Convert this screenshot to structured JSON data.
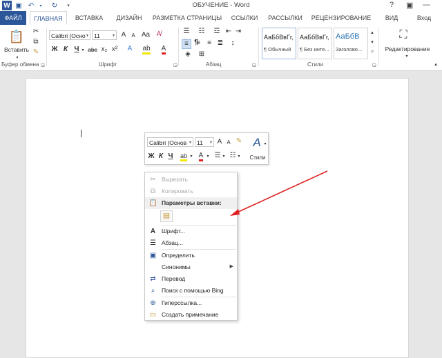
{
  "window": {
    "title": "ОБУЧЕНИЕ - Word",
    "help": "?",
    "signin": "Вход"
  },
  "tabs": [
    {
      "label": "ФАЙЛ"
    },
    {
      "label": "ГЛАВНАЯ"
    },
    {
      "label": "ВСТАВКА"
    },
    {
      "label": "ДИЗАЙН"
    },
    {
      "label": "РАЗМЕТКА СТРАНИЦЫ"
    },
    {
      "label": "ССЫЛКИ"
    },
    {
      "label": "РАССЫЛКИ"
    },
    {
      "label": "РЕЦЕНЗИРОВАНИЕ"
    },
    {
      "label": "ВИД"
    }
  ],
  "ribbon": {
    "paste_label": "Вставить",
    "clipboard_label": "Буфер обмена",
    "font_label": "Шрифт",
    "paragraph_label": "Абзац",
    "styles_label": "Стили",
    "font_name": "Calibri (Осно",
    "font_size": "11",
    "bold": "Ж",
    "italic": "К",
    "underline": "Ч",
    "strike": "abc",
    "sub": "x₂",
    "sup": "x²",
    "grow": "A",
    "shrink": "A",
    "case": "Aa",
    "styles": [
      {
        "sample": "АаБбВвГг,",
        "name": "¶ Обычный"
      },
      {
        "sample": "АаБбВвГг,",
        "name": "¶ Без инте..."
      },
      {
        "sample": "АаБбВ",
        "name": "Заголово..."
      }
    ],
    "editing_label": "Редактирование"
  },
  "minibar": {
    "font_name": "Calibri (Основ",
    "font_size": "11",
    "grow": "A",
    "shrink": "A",
    "bold": "Ж",
    "italic": "К",
    "underline": "Ч",
    "styles_label": "Стили"
  },
  "context_menu": {
    "items": [
      {
        "label": "Вырезать",
        "icon": "cut-icon",
        "disabled": true
      },
      {
        "label": "Копировать",
        "icon": "copy-icon",
        "disabled": true
      },
      {
        "label": "Параметры вставки:",
        "icon": "paste-icon",
        "header": true
      },
      {
        "label": "Шрифт...",
        "icon": "font-icon"
      },
      {
        "label": "Абзац...",
        "icon": "paragraph-icon"
      },
      {
        "label": "Определить",
        "icon": "define-icon"
      },
      {
        "label": "Синонимы",
        "icon": "synonyms-icon"
      },
      {
        "label": "Перевод",
        "icon": "translate-icon"
      },
      {
        "label": "Поиск с помощью Bing",
        "icon": "search-icon"
      },
      {
        "label": "Гиперссылка...",
        "icon": "hyperlink-icon"
      },
      {
        "label": "Создать примечание",
        "icon": "comment-icon"
      }
    ]
  },
  "colors": {
    "accent": "#2b579a",
    "arrow": "#e02020",
    "font_color": "#e02020",
    "highlight": "#f2e600"
  }
}
